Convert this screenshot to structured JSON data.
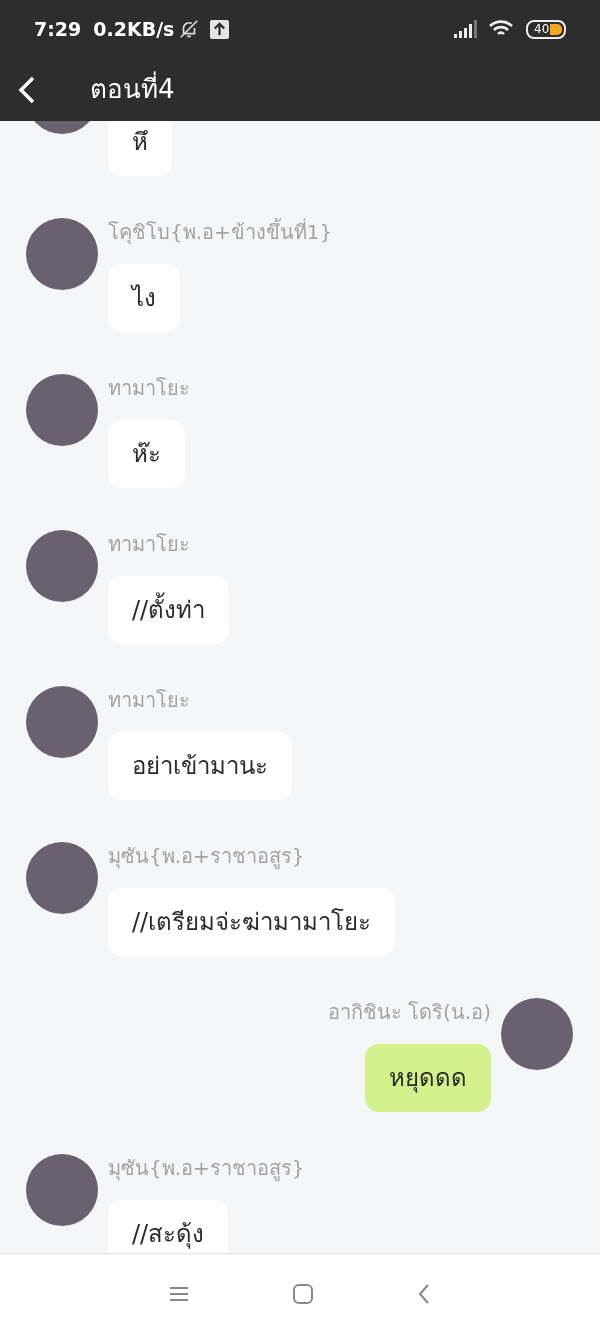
{
  "status_bar": {
    "time": "7:29",
    "speed": "0.2KB/s",
    "battery": "40"
  },
  "header": {
    "title": "ตอนที่4"
  },
  "messages": [
    {
      "kind": "incoming",
      "text": "หึ"
    },
    {
      "kind": "incoming",
      "name": "โคุชิโบ{พ.อ+ข้างขึ้นที่1}",
      "text": "ไง"
    },
    {
      "kind": "incoming",
      "name": "ทามาโยะ",
      "text": "ห๊ะ"
    },
    {
      "kind": "incoming",
      "name": "ทามาโยะ",
      "text": "//ตั้งท่า"
    },
    {
      "kind": "incoming",
      "name": "ทามาโยะ",
      "text": "อย่าเข้ามานะ"
    },
    {
      "kind": "incoming",
      "name": "มุซัน{พ.อ+ราชาอสูร}",
      "text": "//เตรียมจ่ะฆ่ามามาโยะ"
    },
    {
      "kind": "outgoing",
      "name": "อากิชินะ โดริ(น.อ)",
      "text": "หยุดดด"
    },
    {
      "kind": "incoming",
      "name": "มุซัน{พ.อ+ราชาอสูร}",
      "text": "//สะดุ้ง"
    }
  ]
}
